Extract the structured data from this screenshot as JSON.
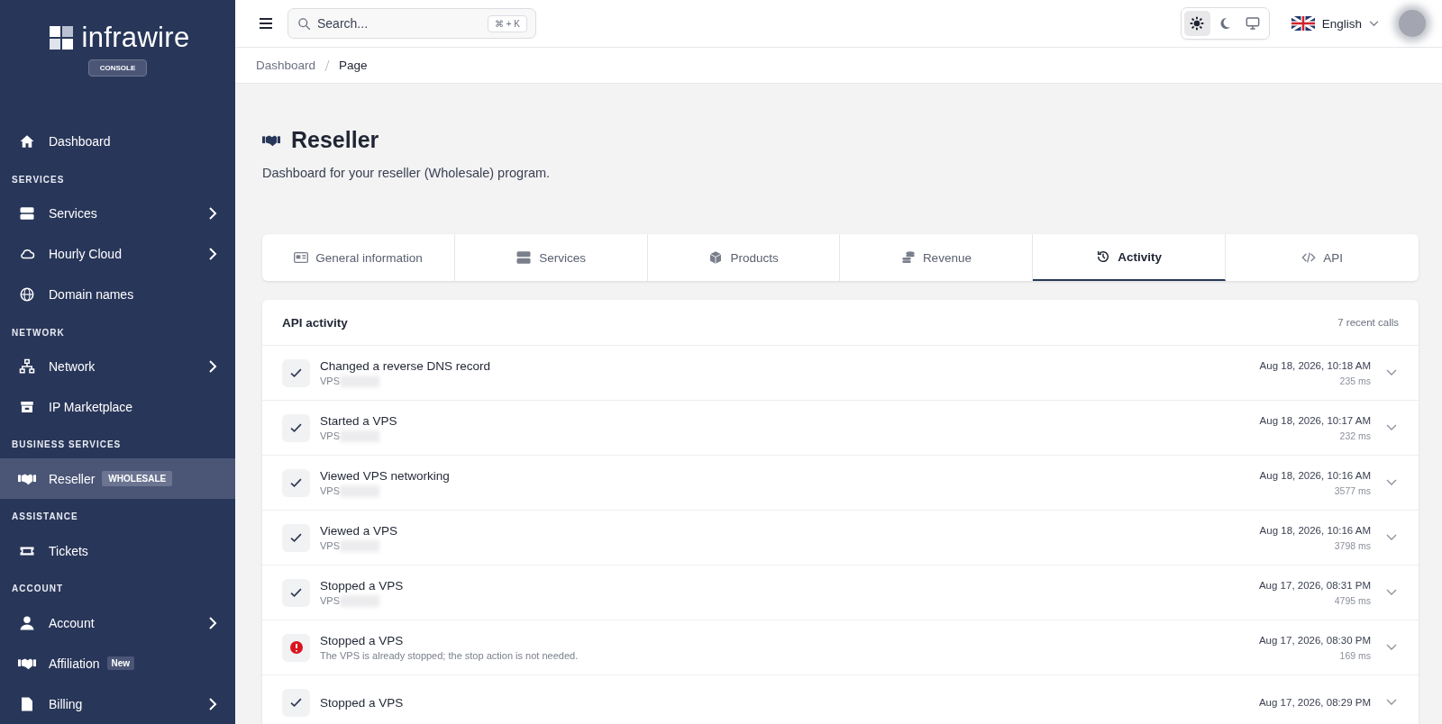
{
  "brand": {
    "name": "infrawire",
    "badge": "CONSOLE"
  },
  "sidebar": {
    "groups": [
      {
        "items": [
          {
            "label": "Dashboard",
            "selected": false,
            "has_submenu": false
          }
        ]
      },
      {
        "heading": "SERVICES",
        "items": [
          {
            "label": "Services",
            "selected": false,
            "has_submenu": true
          },
          {
            "label": "Hourly Cloud",
            "selected": false,
            "has_submenu": true
          },
          {
            "label": "Domain names",
            "selected": false,
            "has_submenu": false
          }
        ]
      },
      {
        "heading": "NETWORK",
        "items": [
          {
            "label": "Network",
            "selected": false,
            "has_submenu": true
          },
          {
            "label": "IP Marketplace",
            "selected": false,
            "has_submenu": false
          }
        ]
      },
      {
        "heading": "BUSINESS SERVICES",
        "items": [
          {
            "label": "Reseller",
            "selected": true,
            "has_submenu": false,
            "badge": "WHOLESALE"
          }
        ]
      },
      {
        "heading": "ASSISTANCE",
        "items": [
          {
            "label": "Tickets",
            "selected": false,
            "has_submenu": false
          }
        ]
      },
      {
        "heading": "ACCOUNT",
        "items": [
          {
            "label": "Account",
            "selected": false,
            "has_submenu": true
          },
          {
            "label": "Affiliation",
            "selected": false,
            "has_submenu": false,
            "badge": "New"
          },
          {
            "label": "Billing",
            "selected": false,
            "has_submenu": true
          }
        ]
      }
    ]
  },
  "topbar": {
    "search": {
      "placeholder": "Search...",
      "shortcut": "⌘ + K"
    },
    "theme_modes": [
      {
        "selected": true
      },
      {
        "selected": false
      },
      {
        "selected": false
      }
    ],
    "language": "English"
  },
  "breadcrumb": [
    "Dashboard",
    "Page"
  ],
  "page": {
    "title": "Reseller",
    "subtitle": "Dashboard for your reseller (Wholesale) program."
  },
  "tabs": [
    {
      "label": "General information",
      "selected": false
    },
    {
      "label": "Services",
      "selected": false
    },
    {
      "label": "Products",
      "selected": false
    },
    {
      "label": "Revenue",
      "selected": false
    },
    {
      "label": "Activity",
      "selected": true
    },
    {
      "label": "API",
      "selected": false
    }
  ],
  "activity": {
    "title": "API activity",
    "count": "7 recent calls",
    "rows": [
      {
        "kind": "success",
        "title": "Changed a reverse DNS record",
        "subtitle": "VPS",
        "redacted": true,
        "time": "Aug 18, 2026, 10:18 AM",
        "duration": "235 ms"
      },
      {
        "kind": "success",
        "title": "Started a VPS",
        "subtitle": "VPS",
        "redacted": true,
        "time": "Aug 18, 2026, 10:17 AM",
        "duration": "232 ms"
      },
      {
        "kind": "success",
        "title": "Viewed VPS networking",
        "subtitle": "VPS",
        "redacted": true,
        "time": "Aug 18, 2026, 10:16 AM",
        "duration": "3577 ms"
      },
      {
        "kind": "success",
        "title": "Viewed a VPS",
        "subtitle": "VPS",
        "redacted": true,
        "time": "Aug 18, 2026, 10:16 AM",
        "duration": "3798 ms"
      },
      {
        "kind": "success",
        "title": "Stopped a VPS",
        "subtitle": "VPS",
        "redacted": true,
        "time": "Aug 17, 2026, 08:31 PM",
        "duration": "4795 ms"
      },
      {
        "kind": "error",
        "title": "Stopped a VPS",
        "subtitle": "The VPS is already stopped; the stop action is not needed.",
        "redacted": false,
        "time": "Aug 17, 2026, 08:30 PM",
        "duration": "169 ms"
      },
      {
        "kind": "success",
        "title": "Stopped a VPS",
        "redacted": false,
        "time": "Aug 17, 2026, 08:29 PM"
      }
    ]
  }
}
